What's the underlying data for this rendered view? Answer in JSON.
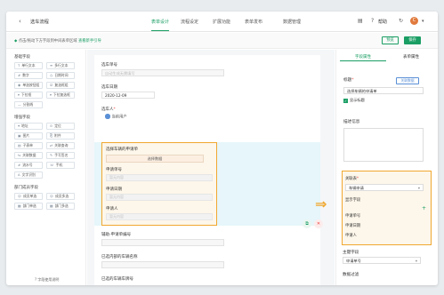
{
  "topbar": {
    "back_icon": "arrow-left-icon",
    "title": "选车流程",
    "tabs": [
      "表单设计",
      "流程设定",
      "扩展功能",
      "表单发布",
      "数据管理"
    ],
    "active_tab": 0,
    "help": "帮助",
    "avatar_letter": "C"
  },
  "toolbar": {
    "note": "点击/拖动下方字段到中间表单区域",
    "note_link": "查看新手引导",
    "preview": "预览",
    "save": "保存"
  },
  "sidebar": {
    "basic_title": "基础字段",
    "basic": [
      {
        "icon": "T",
        "label": "单行文本"
      },
      {
        "icon": "≡",
        "label": "多行文本"
      },
      {
        "icon": "#",
        "label": "数字"
      },
      {
        "icon": "◷",
        "label": "日期时间"
      },
      {
        "icon": "◉",
        "label": "单选按钮组"
      },
      {
        "icon": "☑",
        "label": "复选框组"
      },
      {
        "icon": "▾",
        "label": "下拉框"
      },
      {
        "icon": "▾",
        "label": "下拉复选框"
      },
      {
        "icon": "—",
        "label": "分割线"
      }
    ],
    "enhanced_title": "增强字段",
    "enhanced": [
      {
        "icon": "⌖",
        "label": "地址"
      },
      {
        "icon": "⊙",
        "label": "定位"
      },
      {
        "icon": "▣",
        "label": "图片"
      },
      {
        "icon": "⎘",
        "label": "附件"
      },
      {
        "icon": "▤",
        "label": "子表单"
      },
      {
        "icon": "⇄",
        "label": "关联查询"
      },
      {
        "icon": "⇆",
        "label": "关联数据"
      },
      {
        "icon": "✎",
        "label": "手写签名"
      },
      {
        "icon": "#",
        "label": "流水号"
      },
      {
        "icon": "☏",
        "label": "手机"
      },
      {
        "icon": "A",
        "label": "文字识别"
      }
    ],
    "dept_title": "部门成员字段",
    "dept": [
      {
        "icon": "☺",
        "label": "成员单选"
      },
      {
        "icon": "☺",
        "label": "成员多选"
      },
      {
        "icon": "▦",
        "label": "部门单选"
      },
      {
        "icon": "▦",
        "label": "部门多选"
      }
    ],
    "footer": "字段使用说明"
  },
  "form": {
    "field1_label": "选车单号",
    "field1_placeholder": "自动生成无需填写",
    "field2_label": "选车日期",
    "field2_value": "2020-12-09",
    "field3_label": "选车人",
    "field3_user": "当前用户",
    "subform_title": "选择车辆的申请单",
    "subform_btn": "选择数据",
    "sub_labels": [
      "申请单号",
      "申请日期",
      "申请人"
    ],
    "sub_placeholder": "暂无内容",
    "field5_label": "辅助-申请单编号",
    "field6_label": "已选内部的车辆名称",
    "field7_label": "已选的车辆车牌号"
  },
  "panel": {
    "tab_field": "字段属性",
    "tab_form": "表单属性",
    "title_label": "标题",
    "title_btn": "关联数据",
    "title_value": "选择车辆的申请单",
    "show_title": "显示标题",
    "desc_label": "描述信息",
    "assoc_label": "关联表",
    "assoc_value": "车辆申请",
    "display_label": "显示字段",
    "display_items": [
      "申请单号",
      "申请日期",
      "申请人"
    ],
    "primary_label": "主键字段",
    "primary_value": "申请单号",
    "filter_label": "数据过滤"
  }
}
